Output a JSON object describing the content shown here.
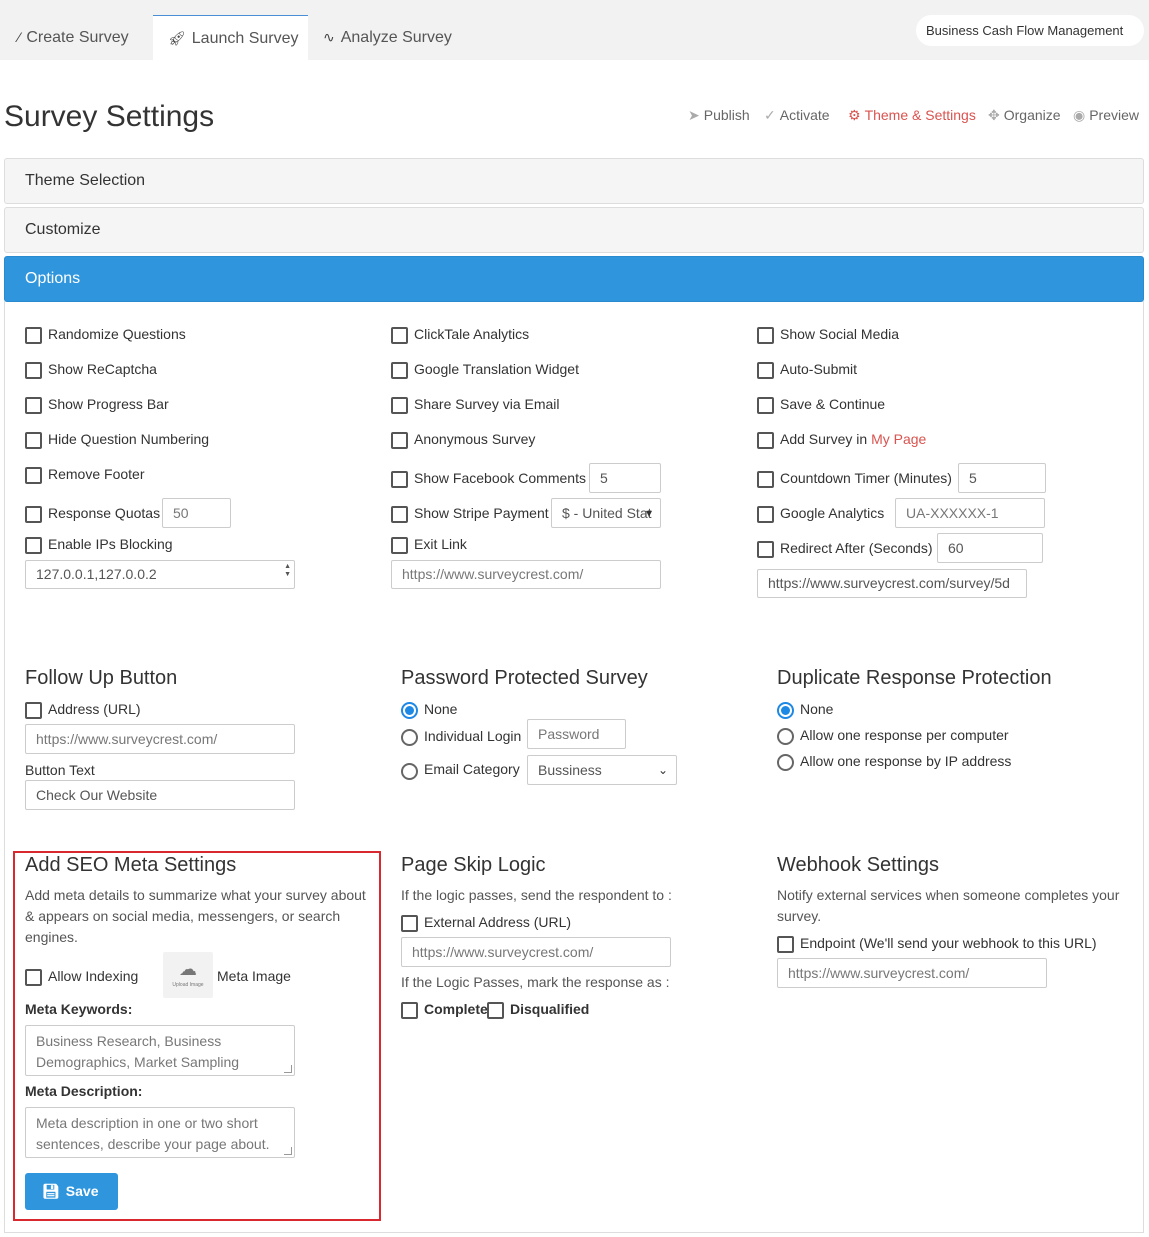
{
  "tabs": [
    {
      "label": "Create Survey",
      "icon": "magic-wand-icon"
    },
    {
      "label": "Launch Survey",
      "icon": "rocket-icon"
    },
    {
      "label": "Analyze Survey",
      "icon": "chart-line-icon"
    }
  ],
  "project_name": "Business Cash Flow Management",
  "page_title": "Survey Settings",
  "steps": [
    {
      "label": "Publish",
      "icon": "send-icon"
    },
    {
      "label": "Activate",
      "icon": "check-icon"
    },
    {
      "label": "Theme & Settings",
      "icon": "gear-icon",
      "active": true
    },
    {
      "label": "Organize",
      "icon": "move-icon"
    },
    {
      "label": "Preview",
      "icon": "eye-icon"
    }
  ],
  "panels": {
    "theme": "Theme Selection",
    "customize": "Customize",
    "options": "Options"
  },
  "options": {
    "randomize": "Randomize Questions",
    "recaptcha": "Show ReCaptcha",
    "progress": "Show Progress Bar",
    "hide_numbering": "Hide Question Numbering",
    "remove_footer": "Remove Footer",
    "response_quotas": "Response Quotas",
    "response_quotas_value": "50",
    "ip_blocking": "Enable IPs Blocking",
    "ip_blocking_value": "127.0.0.1,127.0.0.2",
    "clicktale": "ClickTale Analytics",
    "translation": "Google Translation Widget",
    "share_email": "Share Survey via Email",
    "anonymous": "Anonymous Survey",
    "fb_comments": "Show Facebook Comments",
    "fb_comments_value": "5",
    "stripe": "Show Stripe Payment",
    "stripe_currency": "$ - United Stat",
    "exit_link": "Exit Link",
    "exit_link_placeholder": "https://www.surveycrest.com/",
    "social_media": "Show Social Media",
    "auto_submit": "Auto-Submit",
    "save_continue": "Save & Continue",
    "add_survey_prefix": "Add Survey in ",
    "add_survey_link": "My Page",
    "countdown": "Countdown Timer (Minutes)",
    "countdown_value": "5",
    "google_analytics": "Google Analytics",
    "google_analytics_placeholder": "UA-XXXXXX-1",
    "redirect_after": "Redirect After (Seconds)",
    "redirect_after_value": "60",
    "redirect_url": "https://www.surveycrest.com/survey/5d"
  },
  "follow_up": {
    "title": "Follow Up Button",
    "address_label": "Address (URL)",
    "address_placeholder": "https://www.surveycrest.com/",
    "button_text_label": "Button Text",
    "button_text_value": "Check Our Website"
  },
  "password": {
    "title": "Password Protected Survey",
    "none": "None",
    "individual": "Individual Login",
    "password_placeholder": "Password",
    "email_category": "Email Category",
    "category_value": "Bussiness"
  },
  "duplicate": {
    "title": "Duplicate Response Protection",
    "none": "None",
    "per_computer": "Allow one response per computer",
    "per_ip": "Allow one response by IP address"
  },
  "seo": {
    "title": "Add SEO Meta Settings",
    "description": "Add meta details to summarize what your survey about & appears on social media, messengers, or search engines.",
    "allow_indexing": "Allow Indexing",
    "upload_caption": "Upload Image",
    "meta_image": "Meta Image",
    "keywords_label": "Meta Keywords:",
    "keywords_placeholder": "Business Research, Business Demographics, Market Sampling",
    "description_label": "Meta Description:",
    "description_placeholder": "Meta description in one or two short sentences, describe your page about.",
    "save": "Save"
  },
  "skip_logic": {
    "title": "Page Skip Logic",
    "pass_text": "If the logic passes, send the respondent to :",
    "external_address": "External Address (URL)",
    "url_placeholder": "https://www.surveycrest.com/",
    "mark_text": "If the Logic Passes, mark the response as :",
    "complete": "Complete",
    "disqualified": "Disqualified"
  },
  "webhook": {
    "title": "Webhook Settings",
    "description": "Notify external services when someone completes your survey.",
    "endpoint": "Endpoint (We'll send your webhook to this URL)",
    "url_placeholder": "https://www.surveycrest.com/"
  }
}
